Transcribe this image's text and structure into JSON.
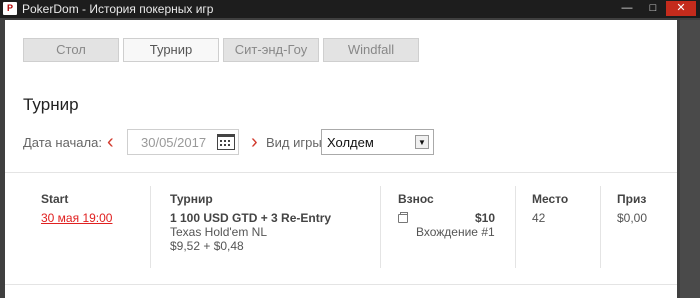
{
  "window": {
    "title": "PokerDom - История покерных игр",
    "app_icon": "P",
    "controls": [
      "—",
      "□",
      "✕"
    ]
  },
  "tabs": [
    {
      "label": "Стол",
      "active": false
    },
    {
      "label": "Турнир",
      "active": true
    },
    {
      "label": "Сит-энд-Гоу",
      "active": false
    },
    {
      "label": "Windfall",
      "active": false
    }
  ],
  "page_title": "Турнир",
  "filters": {
    "start_date_label": "Дата начала:",
    "date_value": "30/05/2017",
    "prev_icon": "chevron-left-icon",
    "next_icon": "chevron-right-icon",
    "calendar_icon": "calendar-icon",
    "game_type_label": "Вид игры:",
    "game_type_value": "Холдем"
  },
  "table": {
    "headers": {
      "start": "Start",
      "tournament": "Турнир",
      "buyin": "Взнос",
      "place": "Место",
      "prize": "Приз"
    },
    "rows": [
      {
        "start": "30 мая 19:00",
        "tournament_name": "1 100 USD GTD + 3 Re-Entry",
        "game": "Texas Hold'em NL",
        "fee": "$9,52 + $0,48",
        "buyin_amount": "$10",
        "buyin_entry": "Вхождение #1",
        "place": "42",
        "prize": "$0,00"
      }
    ]
  },
  "colors": {
    "accent_red": "#e02020",
    "chevron_red": "#d23b2e",
    "close_button": "#c42b1c",
    "titlebar": "#1d1d1d"
  }
}
